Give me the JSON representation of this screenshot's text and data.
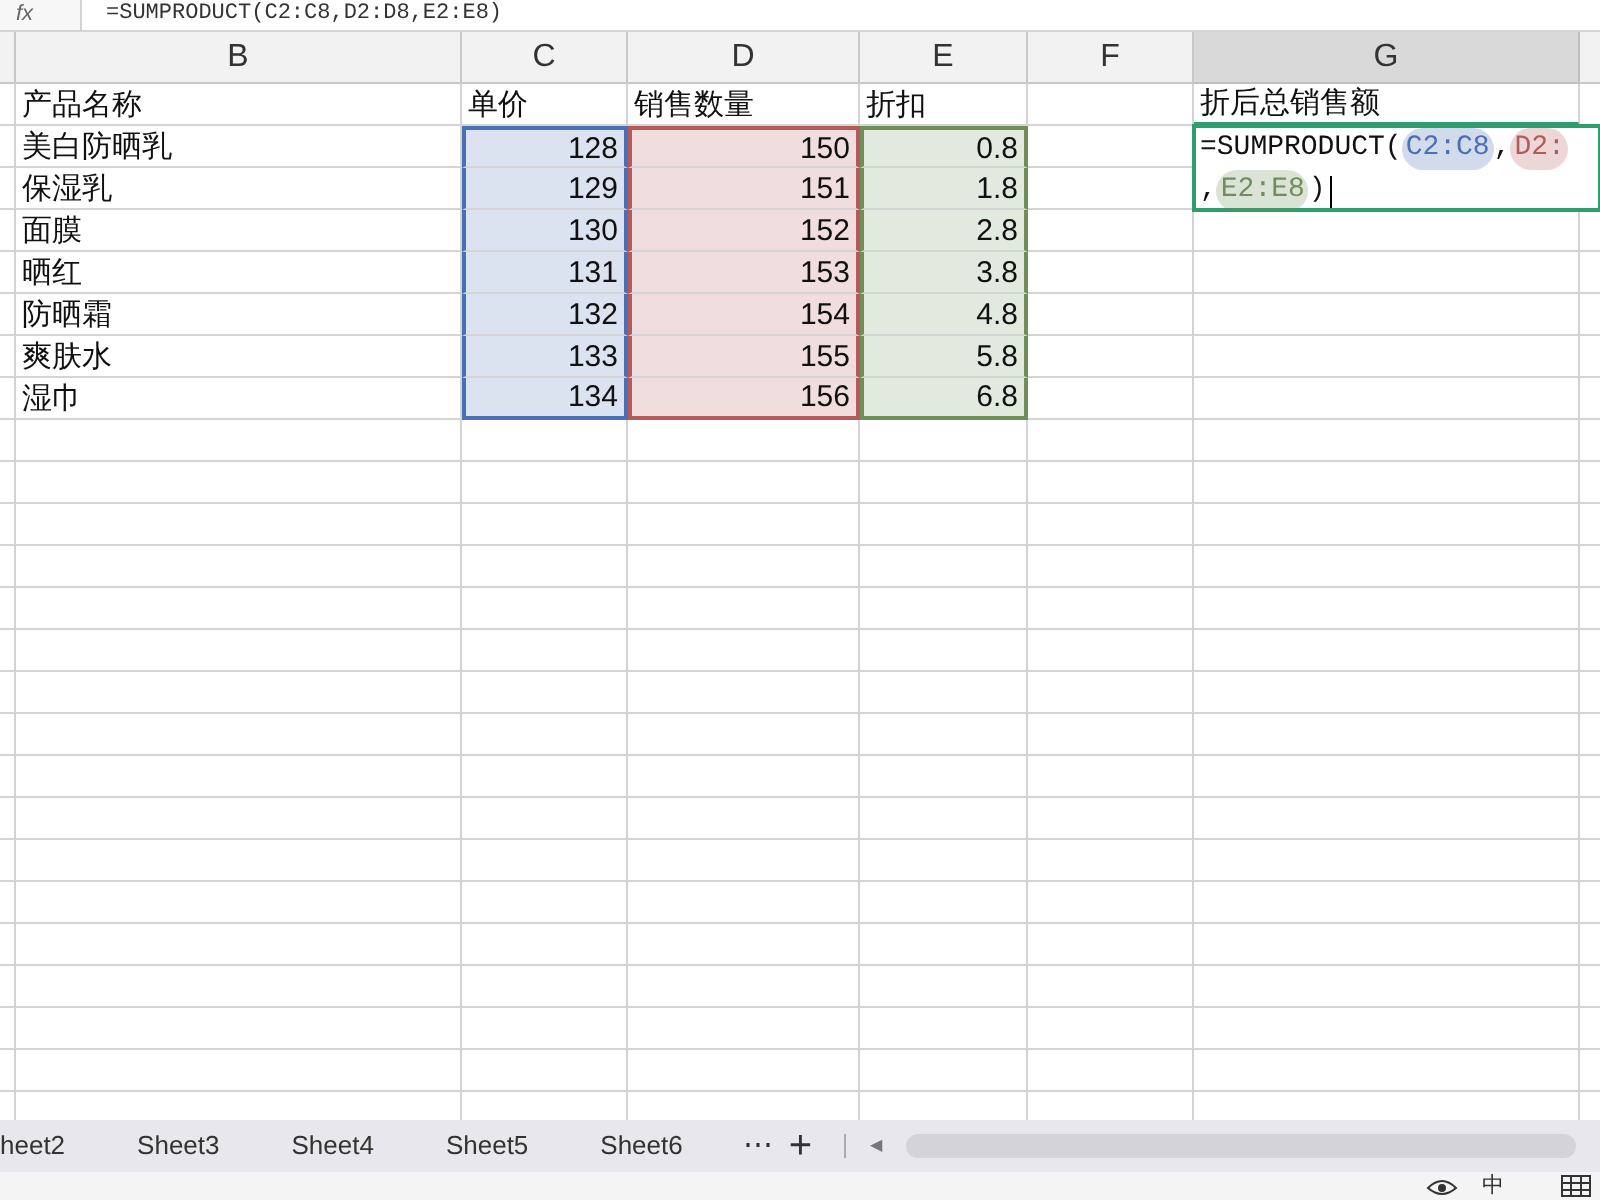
{
  "formula_bar": {
    "label": "fx",
    "text": "=SUMPRODUCT(C2:C8,D2:D8,E2:E8)"
  },
  "columns": [
    {
      "label": "B",
      "selected": false
    },
    {
      "label": "C",
      "selected": false,
      "color": "#4a6fb5"
    },
    {
      "label": "D",
      "selected": false,
      "color": "#b55a5a"
    },
    {
      "label": "E",
      "selected": false,
      "color": "#6f8f5a"
    },
    {
      "label": "F",
      "selected": false
    },
    {
      "label": "G",
      "selected": true
    }
  ],
  "header_row": {
    "name": "产品名称",
    "price": "单价",
    "quantity": "销售数量",
    "discount": "折扣",
    "total": "折后总销售额"
  },
  "rows": [
    {
      "name": "美白防晒乳",
      "price": "128",
      "quantity": "150",
      "discount": "0.8"
    },
    {
      "name": "保湿乳",
      "price": "129",
      "quantity": "151",
      "discount": "1.8"
    },
    {
      "name": "面膜",
      "price": "130",
      "quantity": "152",
      "discount": "2.8"
    },
    {
      "name": "晒红",
      "price": "131",
      "quantity": "153",
      "discount": "3.8"
    },
    {
      "name": "防晒霜",
      "price": "132",
      "quantity": "154",
      "discount": "4.8"
    },
    {
      "name": "爽肤水",
      "price": "133",
      "quantity": "155",
      "discount": "5.8"
    },
    {
      "name": "湿巾",
      "price": "134",
      "quantity": "156",
      "discount": "6.8"
    }
  ],
  "editor": {
    "lines": [
      [
        {
          "kind": "text",
          "text": "=SUMPRODUCT("
        },
        {
          "kind": "ref",
          "text": "C2:C8",
          "color": "#4a6fb5"
        },
        {
          "kind": "text",
          "text": ","
        },
        {
          "kind": "ref",
          "text": "D2:",
          "color": "#b55a5a"
        }
      ],
      [
        {
          "kind": "text",
          "text": ","
        },
        {
          "kind": "ref",
          "text": "E2:E8",
          "color": "#6f8f5a"
        },
        {
          "kind": "text",
          "text": ")"
        }
      ]
    ]
  },
  "sheet_tabs": [
    {
      "label": "heet2",
      "selected": false
    },
    {
      "label": "Sheet3",
      "selected": false
    },
    {
      "label": "Sheet4",
      "selected": false
    },
    {
      "label": "Sheet5",
      "selected": false
    },
    {
      "label": "Sheet6",
      "selected": false
    }
  ],
  "tab_controls": {
    "more": "⋯",
    "add": "+",
    "scroll_left": "◀"
  },
  "status_bar": {
    "input_method": "中"
  }
}
